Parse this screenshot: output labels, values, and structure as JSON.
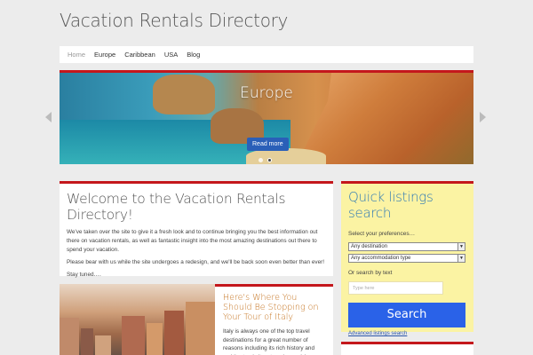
{
  "site": {
    "title": "Vacation Rentals Directory"
  },
  "nav": {
    "items": [
      "Home",
      "Europe",
      "Caribbean",
      "USA",
      "Blog"
    ]
  },
  "slider": {
    "title": "Europe",
    "button": "Read more",
    "slides_total": 2,
    "active_slide": 1
  },
  "welcome": {
    "heading": "Welcome to the Vacation Rentals Directory!",
    "p1": "We've taken over the site to give it a fresh look and to continue bringing you the best information out there on vacation rentals, as well as fantastic insight into the most amazing destinations out there to spend your vacation.",
    "p2": "Please bear with us while the site undergoes a redesign, and we'll be back soon even better than ever!",
    "p3": "Stay tuned…."
  },
  "post": {
    "title": "Here's Where You Should Be Stopping on Your Tour of Italy",
    "excerpt": "Italy is always one of the top travel destinations for a great number of reasons including its rich history and architectural sites, top-class cuisine"
  },
  "search": {
    "heading": "Quick listings search",
    "prefs_label": "Select your preferences…",
    "destination": "Any destination",
    "accommodation": "Any accommodation type",
    "text_label": "Or search by text",
    "placeholder": "Type here",
    "button": "Search",
    "advanced": "Advanced listings search"
  },
  "colors": {
    "accent_red": "#c4171c",
    "search_bg": "#fbf3a3",
    "button_blue": "#2a62e8",
    "heading_blue": "#2f7ab5"
  }
}
